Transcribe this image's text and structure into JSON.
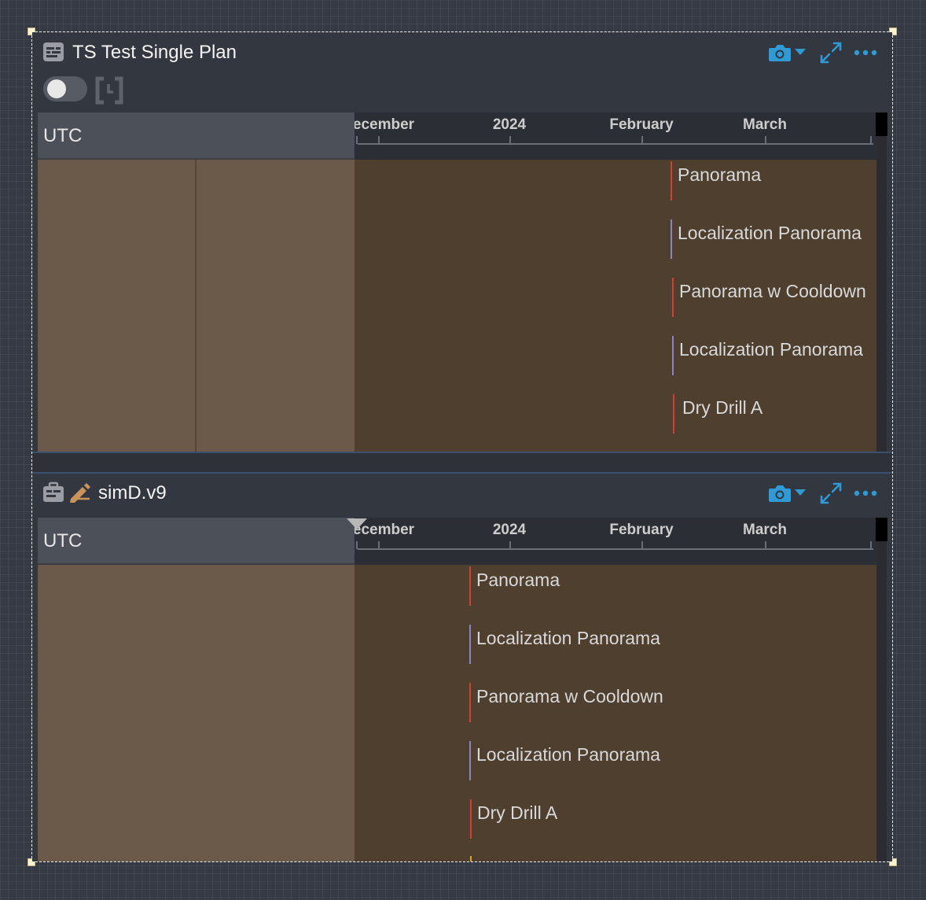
{
  "panels": [
    {
      "title": "TS Test Single Plan",
      "timezone": "UTC",
      "axis_ticks": [
        "ecember",
        "2024",
        "February",
        "March"
      ],
      "activities": [
        {
          "label": "Panorama",
          "color": "#d93d2f"
        },
        {
          "label": "Localization Panorama",
          "color": "#8b82c9"
        },
        {
          "label": "Panorama w Cooldown",
          "color": "#d93d2f"
        },
        {
          "label": "Localization Panorama",
          "color": "#8b82c9"
        },
        {
          "label": "Dry Drill A",
          "color": "#d93d2f"
        }
      ]
    },
    {
      "title": "simD.v9",
      "timezone": "UTC",
      "axis_ticks": [
        "ecember",
        "2024",
        "February",
        "March"
      ],
      "activities": [
        {
          "label": "Panorama",
          "color": "#d93d2f"
        },
        {
          "label": "Localization Panorama",
          "color": "#8b82c9"
        },
        {
          "label": "Panorama w Cooldown",
          "color": "#d93d2f"
        },
        {
          "label": "Localization Panorama",
          "color": "#8b82c9"
        },
        {
          "label": "Dry Drill A",
          "color": "#d93d2f"
        }
      ]
    }
  ],
  "icons": {
    "camera": "camera-icon",
    "dropdown": "caret-down-icon",
    "expand": "expand-icon",
    "more": "more-horizontal-icon",
    "plan": "plan-icon",
    "simulation": "briefcase-icon",
    "edit": "pencil-icon",
    "bracket": "time-bracket-icon"
  },
  "colors": {
    "accent": "#2e9bd6",
    "edit_icon": "#c9955a",
    "activity_red": "#d93d2f",
    "activity_purple": "#8b82c9"
  }
}
